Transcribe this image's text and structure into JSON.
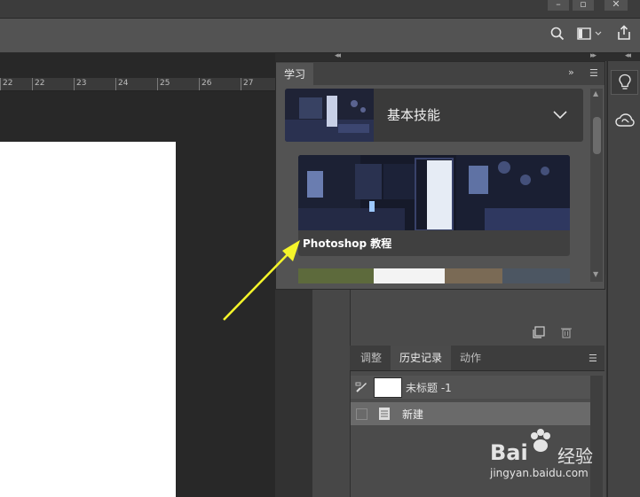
{
  "window": {
    "minimize_icon": "minimize-icon",
    "restore_icon": "restore-icon",
    "close_icon": "close-icon"
  },
  "options_bar": {
    "search_icon": "search-icon",
    "workspace_icon": "workspace-icon",
    "share_icon": "share-icon"
  },
  "ruler": {
    "ticks": [
      "22",
      "23",
      "24",
      "25",
      "26",
      "27"
    ]
  },
  "learn_panel": {
    "tab_label": "学习",
    "section_title": "基本技能",
    "tutorial_title": "Photoshop 教程"
  },
  "history_panel": {
    "tabs": [
      "调整",
      "历史记录",
      "动作"
    ],
    "active_tab": "历史记录",
    "snapshot_label": "未标题 -1",
    "state_new": "新建"
  },
  "watermark": {
    "brand": "Bai",
    "brand_suffix": "经验",
    "url": "jingyan.baidu.com"
  },
  "colors": {
    "arrow": "#f5f52a",
    "canvas": "#ffffff"
  }
}
